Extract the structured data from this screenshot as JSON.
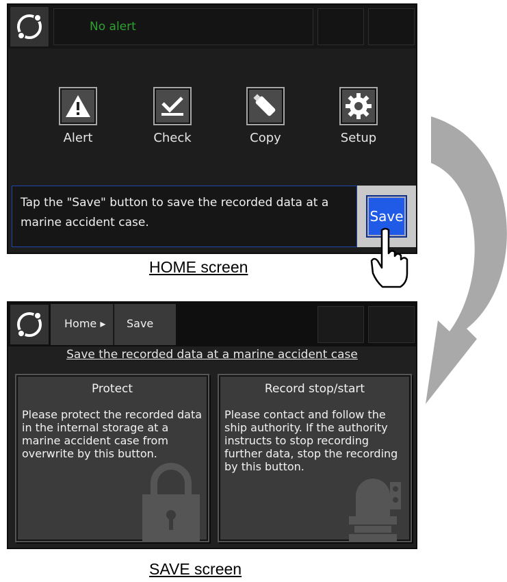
{
  "home": {
    "alert_text": "No alert",
    "menu": [
      {
        "label": "Alert",
        "icon": "warning-icon"
      },
      {
        "label": "Check",
        "icon": "checkmark-icon"
      },
      {
        "label": "Copy",
        "icon": "usb-drive-icon"
      },
      {
        "label": "Setup",
        "icon": "gear-icon"
      }
    ],
    "info_text": "Tap the \"Save\" button to save the recorded data at a marine accident case.",
    "save_button": "Save",
    "caption": "HOME screen"
  },
  "save": {
    "breadcrumb": [
      "Home ▸",
      "Save"
    ],
    "heading": "Save the recorded data at a marine accident case",
    "panels": [
      {
        "title": "Protect",
        "text": "Please protect the recorded data in the internal storage at a marine accident case from overwrite by this button.",
        "icon": "padlock-icon"
      },
      {
        "title": "Record stop/start",
        "text": "Please contact and follow the ship authority. If the authority instructs to stop recording further data, stop the recording by this button.",
        "icon": "recorder-icon"
      }
    ],
    "caption": "SAVE screen"
  },
  "colors": {
    "accent_blue": "#1f5be6",
    "alert_green": "#2fa12f",
    "screen_bg": "#1d1d1d"
  }
}
